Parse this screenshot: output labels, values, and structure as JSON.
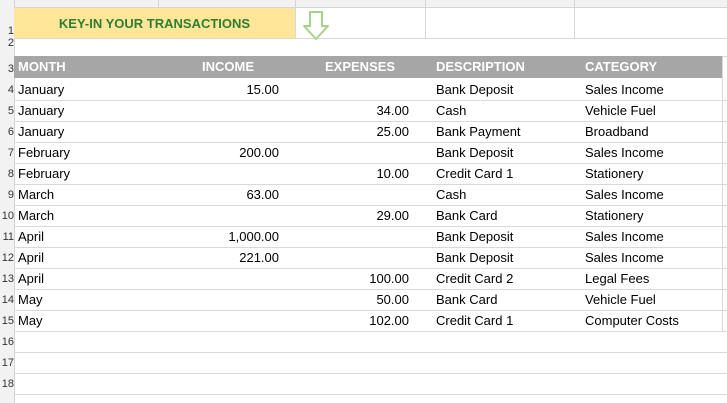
{
  "banner": {
    "title": "KEY-IN YOUR TRANSACTIONS"
  },
  "headers": {
    "month": "MONTH",
    "income": "INCOME",
    "expenses": "EXPENSES",
    "description": "DESCRIPTION",
    "category": "CATEGORY"
  },
  "row_numbers": {
    "r1": "1",
    "r2": "2",
    "r3": "3",
    "r4": "4",
    "r5": "5",
    "r6": "6",
    "r7": "7",
    "r8": "8",
    "r9": "9",
    "r10": "10",
    "r11": "11",
    "r12": "12",
    "r13": "13",
    "r14": "14",
    "r15": "15",
    "r16": "16",
    "r17": "17",
    "r18": "18"
  },
  "rows": [
    {
      "month": "January",
      "income": "15.00",
      "expenses": "",
      "description": "Bank Deposit",
      "category": "Sales Income"
    },
    {
      "month": "January",
      "income": "",
      "expenses": "34.00",
      "description": "Cash",
      "category": "Vehicle Fuel"
    },
    {
      "month": "January",
      "income": "",
      "expenses": "25.00",
      "description": "Bank Payment",
      "category": "Broadband"
    },
    {
      "month": "February",
      "income": "200.00",
      "expenses": "",
      "description": "Bank Deposit",
      "category": "Sales Income"
    },
    {
      "month": "February",
      "income": "",
      "expenses": "10.00",
      "description": "Credit Card 1",
      "category": "Stationery"
    },
    {
      "month": "March",
      "income": "63.00",
      "expenses": "",
      "description": "Cash",
      "category": "Sales Income"
    },
    {
      "month": "March",
      "income": "",
      "expenses": "29.00",
      "description": "Bank Card",
      "category": "Stationery"
    },
    {
      "month": "April",
      "income": "1,000.00",
      "expenses": "",
      "description": "Bank Deposit",
      "category": "Sales Income"
    },
    {
      "month": "April",
      "income": "221.00",
      "expenses": "",
      "description": "Bank Deposit",
      "category": "Sales Income"
    },
    {
      "month": "April",
      "income": "",
      "expenses": "100.00",
      "description": "Credit Card 2",
      "category": "Legal Fees"
    },
    {
      "month": "May",
      "income": "",
      "expenses": "50.00",
      "description": "Bank Card",
      "category": "Vehicle Fuel"
    },
    {
      "month": "May",
      "income": "",
      "expenses": "102.00",
      "description": "Credit Card 1",
      "category": "Computer Costs"
    }
  ],
  "colors": {
    "banner_bg": "#ffe699",
    "banner_text": "#2e7d32",
    "header_bg": "#a6a6a6",
    "arrow": "#a9d18e"
  },
  "icons": {
    "arrow": "down-arrow-icon"
  }
}
